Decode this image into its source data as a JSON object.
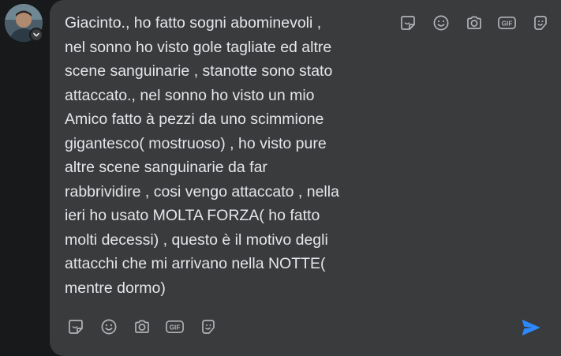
{
  "composer": {
    "message": "Giacinto., ho fatto sogni abominevoli ,\nnel sonno ho visto gole tagliate ed altre\nscene sanguinarie , stanotte sono stato\nattaccato., nel sonno ho visto un mio\nAmico fatto à pezzi da uno scimmione\ngigantesco( mostruoso) , ho visto pure\naltre scene sanguinarie da far\nrabbrividire , cosi vengo attaccato , nella\nieri ho usato MOLTA FORZA( ho fatto\nmolti decessi) , questo è il motivo degli\nattacchi che mi arrivano nella NOTTE(\nmentre dormo)"
  },
  "icons": {
    "top": [
      "sticker-icon",
      "emoji-icon",
      "camera-icon",
      "gif-icon",
      "avatar-sticker-icon"
    ],
    "bottom": [
      "sticker-icon",
      "emoji-icon",
      "camera-icon",
      "gif-icon",
      "avatar-sticker-icon"
    ],
    "gif_label": "GIF",
    "send": "send-icon"
  },
  "colors": {
    "background": "#18191a",
    "composer": "#3a3b3c",
    "text": "#e4e6eb",
    "icon": "#b0b3b8",
    "send": "#2d88ff"
  }
}
